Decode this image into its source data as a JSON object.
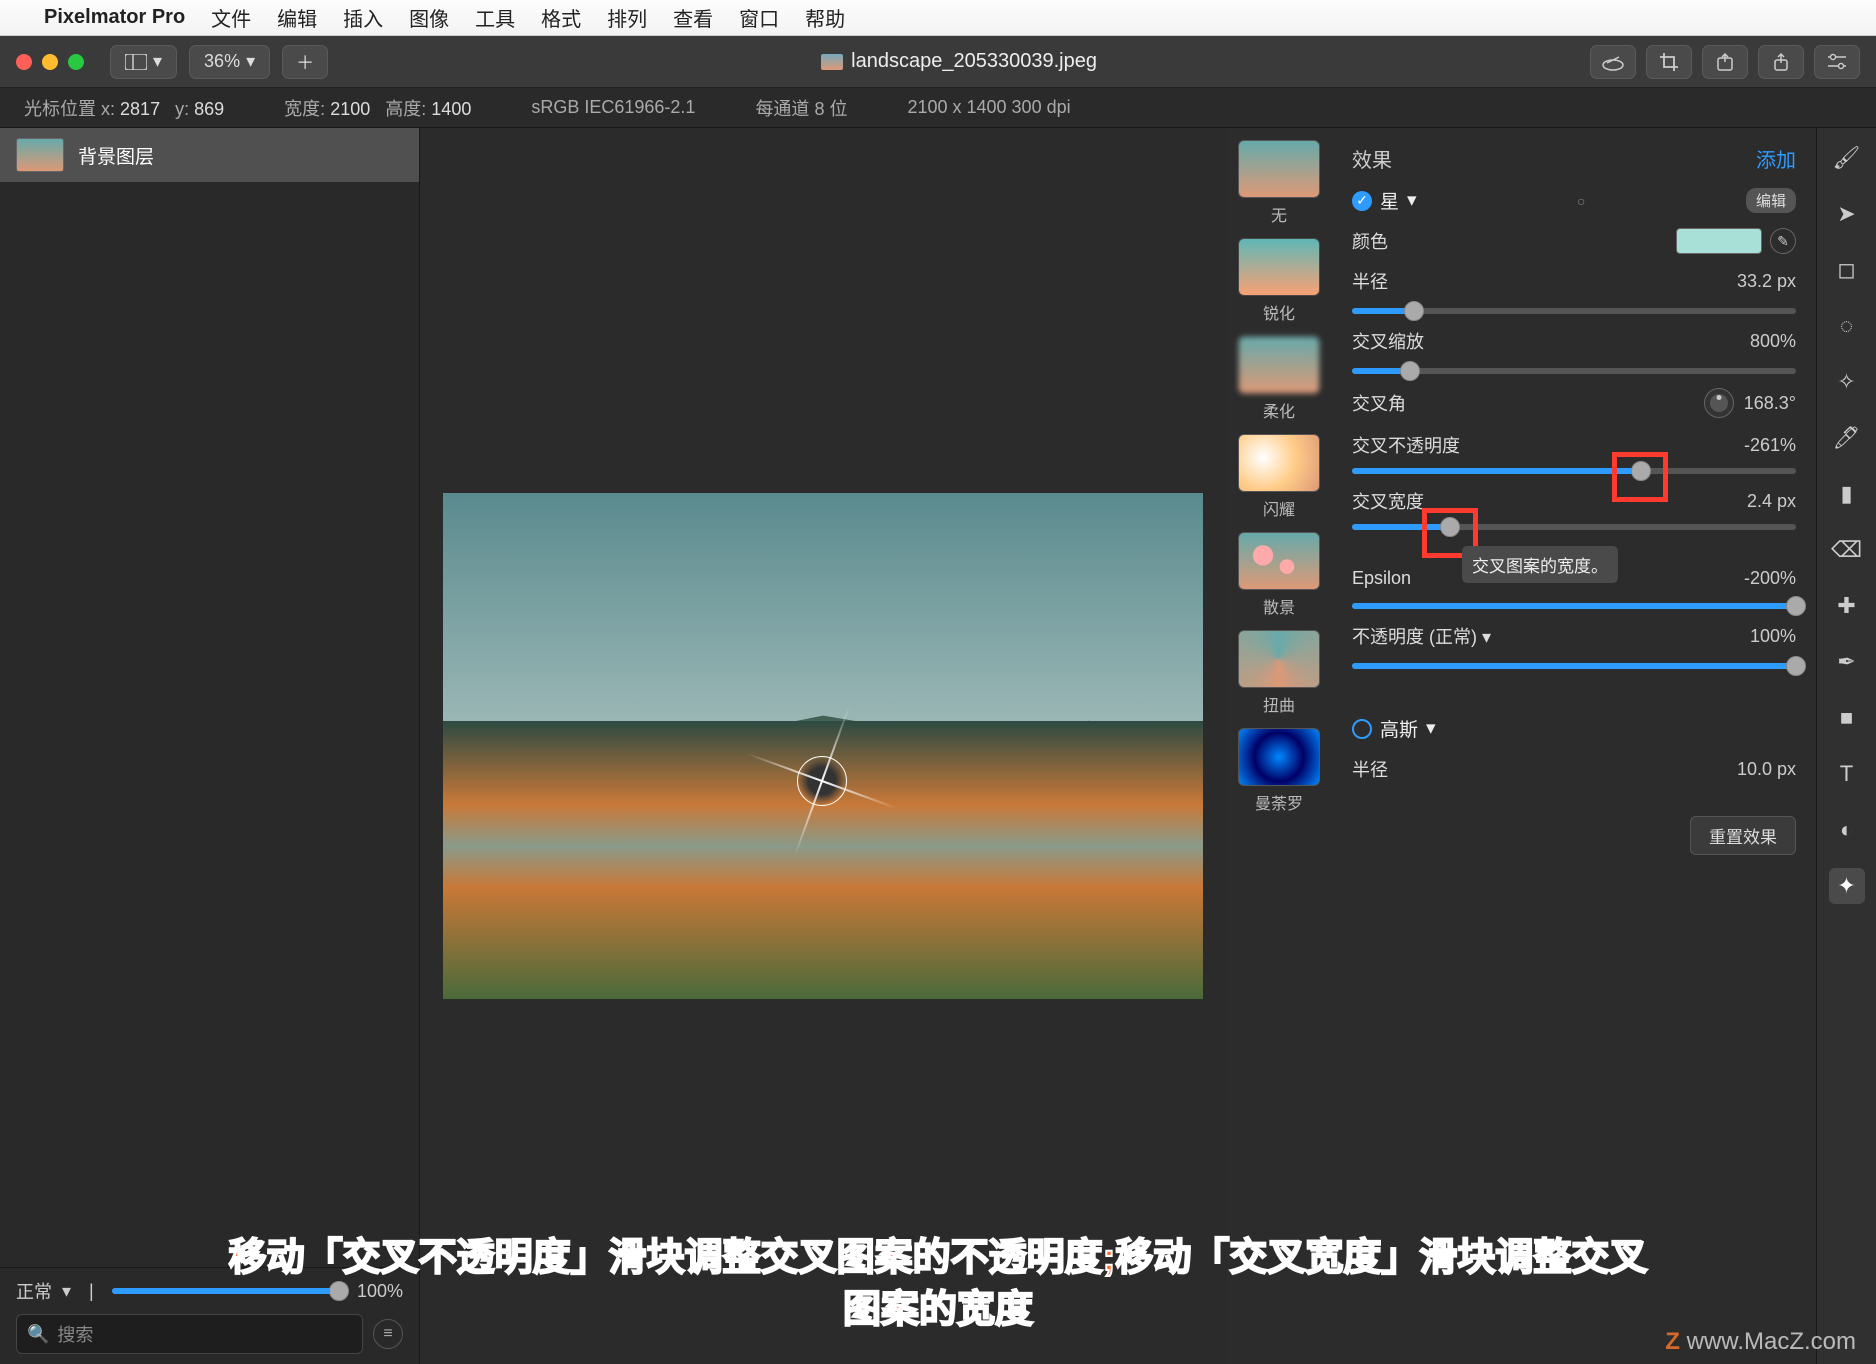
{
  "menubar": {
    "app": "Pixelmator Pro",
    "items": [
      "文件",
      "编辑",
      "插入",
      "图像",
      "工具",
      "格式",
      "排列",
      "查看",
      "窗口",
      "帮助"
    ]
  },
  "toolbar": {
    "zoom": "36%",
    "title": "landscape_205330039.jpeg"
  },
  "infobar": {
    "cursor_label": "光标位置 x:",
    "cursor_x": "2817",
    "cursor_y_label": "y:",
    "cursor_y": "869",
    "width_label": "宽度:",
    "width": "2100",
    "height_label": "高度:",
    "height": "1400",
    "color_profile": "sRGB IEC61966-2.1",
    "bits": "每通道 8 位",
    "dims": "2100 x 1400 300 dpi"
  },
  "layers": {
    "bg": "背景图层",
    "blend_label": "正常",
    "opacity": "100%",
    "search_placeholder": "搜索"
  },
  "fx": {
    "header": "效果",
    "add": "添加",
    "group1": {
      "name": "星",
      "edit": "编辑",
      "color_label": "颜色",
      "radius_label": "半径",
      "radius_val": "33.2 px",
      "cross_scale_label": "交叉缩放",
      "cross_scale_val": "800%",
      "cross_angle_label": "交叉角",
      "cross_angle_val": "168.3°",
      "cross_opacity_label": "交叉不透明度",
      "cross_opacity_val": "-261%",
      "cross_width_label": "交叉宽度",
      "cross_width_val": "2.4 px",
      "epsilon_label": "Epsilon",
      "epsilon_val": "-200%",
      "opacity_label": "不透明度 (正常)",
      "opacity_val": "100%",
      "tooltip": "交叉图案的宽度。"
    },
    "group2": {
      "name": "高斯",
      "radius_label": "半径",
      "radius_val": "10.0 px"
    },
    "reset": "重置效果"
  },
  "presets": {
    "none": "无",
    "sharpen": "锐化",
    "soften": "柔化",
    "glare": "闪耀",
    "bokeh": "散景",
    "twist": "扭曲",
    "mandala": "曼荼罗"
  },
  "annotation": {
    "line1": "移动「交叉不透明度」滑块调整交叉图案的不透明度;移动「交叉宽度」滑块调整交叉",
    "line2": "图案的宽度"
  },
  "watermark": "www.MacZ.com"
}
